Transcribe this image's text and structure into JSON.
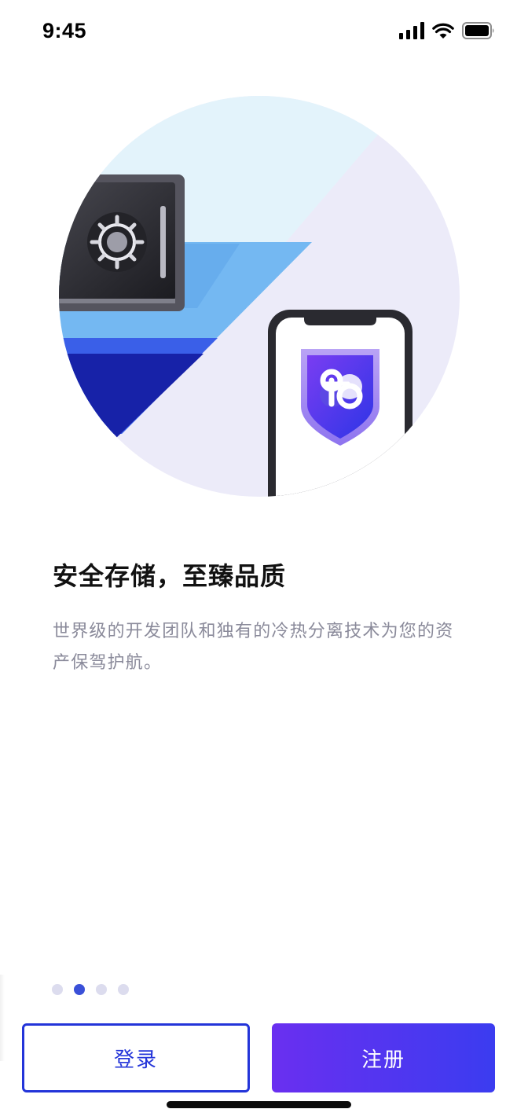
{
  "status_bar": {
    "time": "9:45",
    "icons": [
      "cellular-signal-icon",
      "wifi-icon",
      "battery-icon"
    ]
  },
  "illustration": {
    "icons": [
      "vault-safe-icon",
      "smartphone-icon",
      "shield-logo-icon"
    ],
    "colors": {
      "sky": "#e3f3fb",
      "lavender": "#ecebf9",
      "water_light": "#74b8f2",
      "water_mid": "#3a5fe8",
      "water_dark": "#1722a8",
      "shield_purple": "#6a3cf0"
    }
  },
  "onboarding": {
    "headline": "安全存储，至臻品质",
    "description": "世界级的开发团队和独有的冷热分离技术为您的资产保驾护航。"
  },
  "pager": {
    "total": 4,
    "active_index": 1
  },
  "buttons": {
    "login_label": "登录",
    "register_label": "注册"
  },
  "colors": {
    "accent": "#2334d9",
    "register_gradient_start": "#6a2ff0",
    "register_gradient_end": "#3b3cf0",
    "dot_active": "#3a50d8",
    "dot_inactive": "#dcdcee"
  }
}
